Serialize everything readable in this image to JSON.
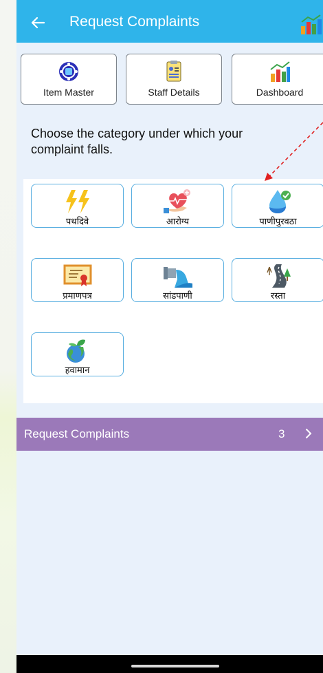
{
  "appbar": {
    "title": "Request Complaints"
  },
  "quick_links": [
    {
      "label": "Item Master",
      "icon": "item-master-icon"
    },
    {
      "label": "Staff Details",
      "icon": "staff-details-icon"
    },
    {
      "label": "Dashboard",
      "icon": "dashboard-icon"
    }
  ],
  "prompt": "Choose the category under which your complaint falls.",
  "categories": [
    {
      "label": "पथदिवे",
      "icon": "lightning-icon"
    },
    {
      "label": "आरोग्य",
      "icon": "heart-health-icon"
    },
    {
      "label": "पाणीपुरवठा",
      "icon": "water-drop-icon"
    },
    {
      "label": "प्रमाणपत्र",
      "icon": "certificate-icon"
    },
    {
      "label": "सांडपाणी",
      "icon": "drain-icon"
    },
    {
      "label": "रस्ता",
      "icon": "road-icon"
    },
    {
      "label": "हवामान",
      "icon": "globe-plant-icon"
    }
  ],
  "banner": {
    "label": "Request Complaints",
    "count": "3"
  },
  "colors": {
    "appbar": "#2fb4ea",
    "banner": "#9b79b9",
    "card_border": "#58aee0",
    "background": "#e9f1fb"
  }
}
